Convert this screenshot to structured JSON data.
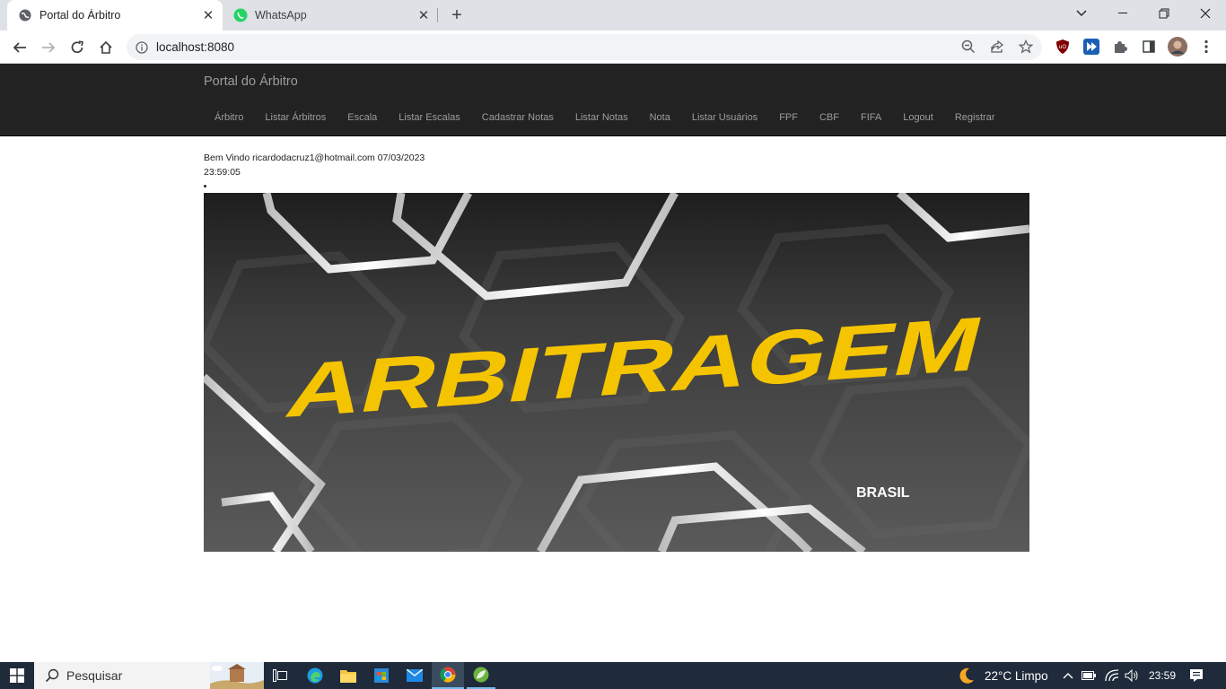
{
  "browser": {
    "tabs": [
      {
        "title": "Portal do Árbitro",
        "active": true
      },
      {
        "title": "WhatsApp",
        "active": false
      }
    ],
    "url": "localhost:8080"
  },
  "site": {
    "brand": "Portal do Árbitro",
    "menu": [
      "Árbitro",
      "Listar Árbitros",
      "Escala",
      "Listar Escalas",
      "Cadastrar Notas",
      "Listar Notas",
      "Nota",
      "Listar Usuários",
      "FPF",
      "CBF",
      "FIFA",
      "Logout",
      "Registrar"
    ],
    "welcome_line1": "Bem Vindo ricardodacruz1@hotmail.com 07/03/2023",
    "welcome_line2": "23:59:05",
    "banner": {
      "title": "ARBITRAGEM",
      "subtitle": "BRASIL",
      "title_color": "#f5c400"
    }
  },
  "taskbar": {
    "search_placeholder": "Pesquisar",
    "weather": "22°C  Limpo",
    "time": "23:59"
  }
}
